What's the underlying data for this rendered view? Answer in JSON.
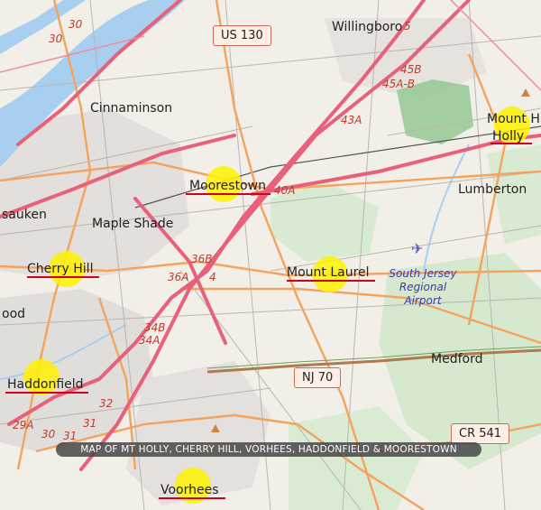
{
  "caption": "MAP OF MT HOLLY, CHERRY HILL, VORHEES, HADDONFIELD & MOORESTOWN",
  "places": {
    "willingboro": "Willingboro",
    "cinnaminson": "Cinnaminson",
    "moorestown": "Moorestown",
    "sauken": "sauken",
    "maple_shade": "Maple Shade",
    "cherry_hill": "Cherry Hill",
    "mount_laurel": "Mount Laurel",
    "lumberton": "Lumberton",
    "mount_holly_1": "Mount H",
    "mount_holly_2": "Holly",
    "medford": "Medford",
    "haddonfield": "Haddonfield",
    "voorhees": "Voorhees",
    "ood": "ood"
  },
  "airport": {
    "line1": "South Jersey",
    "line2": "Regional",
    "line3": "Airport"
  },
  "shields": {
    "us130": "US 130",
    "nj70": "NJ 70",
    "cr541": "CR 541"
  },
  "exits": {
    "e45b": "45B",
    "e45ab": "45A-B",
    "e43a": "43A",
    "e40a": "40A",
    "e36b": "36B",
    "e36a": "36A",
    "e4": "4",
    "e34b": "34B",
    "e34a": "34A",
    "e32": "32",
    "e31": "31",
    "e30": "30",
    "e29a": "29A",
    "e30b": "30",
    "e31b": "31",
    "e5": "5",
    "e30top": "30"
  },
  "colors": {
    "highlight": "#fff200",
    "underline": "#d0021b",
    "highway": "#e8607a",
    "primary_road": "#f5a35c",
    "water": "#a9cff0",
    "park": "#8fc58f"
  }
}
